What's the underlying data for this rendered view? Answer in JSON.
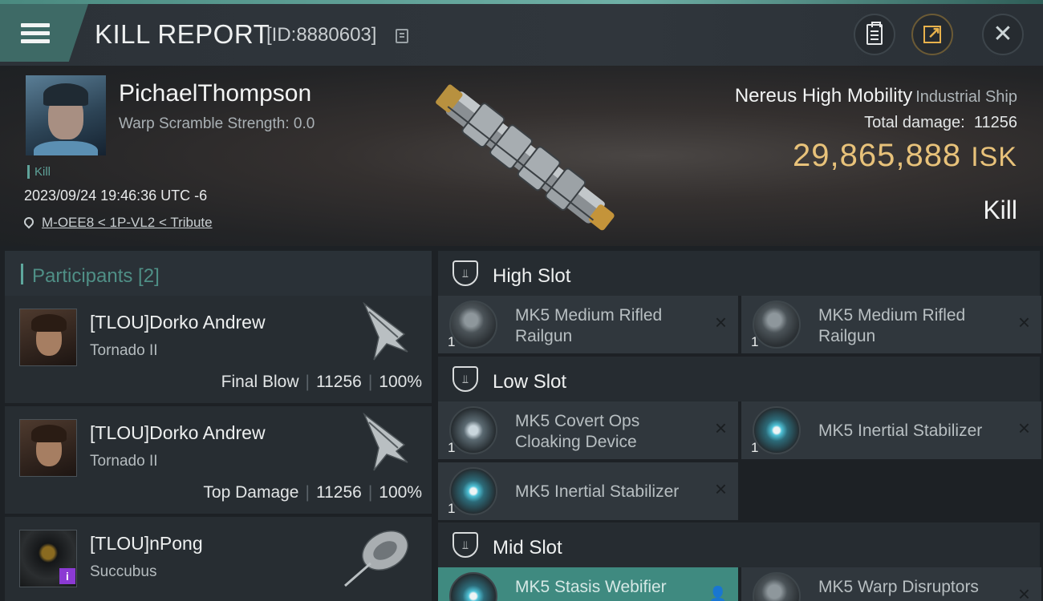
{
  "header": {
    "title": "KILL REPORT",
    "report_id": "[ID:8880603]"
  },
  "victim": {
    "name": "PichaelThompson",
    "warp_scramble": "Warp Scramble Strength: 0.0",
    "tag": "Kill",
    "timestamp": "2023/09/24 19:46:36 UTC -6",
    "location": "M-OEE8 < 1P-VL2 < Tribute",
    "ship_name": "Nereus High Mobility",
    "ship_class": "Industrial Ship",
    "total_damage_label": "Total damage:",
    "total_damage_value": "11256",
    "isk_value": "29,865,888",
    "isk_unit": "ISK",
    "result": "Kill"
  },
  "participants": {
    "header": "Participants [2]",
    "items": [
      {
        "name": "[TLOU]Dorko Andrew",
        "ship": "Tornado II",
        "role": "Final Blow",
        "damage": "11256",
        "percent": "100%"
      },
      {
        "name": "[TLOU]Dorko Andrew",
        "ship": "Tornado II",
        "role": "Top Damage",
        "damage": "11256",
        "percent": "100%"
      },
      {
        "name": "[TLOU]nPong",
        "ship": "Succubus",
        "badge": "i"
      }
    ]
  },
  "slots": {
    "high": {
      "label": "High Slot",
      "modules": [
        {
          "name": "MK5 Medium Rifled Railgun",
          "qty": "1"
        },
        {
          "name": "MK5 Medium Rifled Railgun",
          "qty": "1"
        }
      ]
    },
    "low": {
      "label": "Low Slot",
      "modules": [
        {
          "name": "MK5 Covert Ops Cloaking Device",
          "qty": "1"
        },
        {
          "name": "MK5 Inertial Stabilizer",
          "qty": "1"
        },
        {
          "name": "MK5 Inertial Stabilizer",
          "qty": "1"
        }
      ]
    },
    "mid": {
      "label": "Mid Slot",
      "modules": [
        {
          "name": "MK5 Stasis Webifier",
          "qty": "1"
        },
        {
          "name": "MK5 Warp Disruptors",
          "qty": "1"
        }
      ]
    }
  },
  "icons": {
    "remove": "×",
    "slot": "shield-icon"
  },
  "colors": {
    "accent": "#5ea79d",
    "isk": "#e8c27a",
    "active_module": "#3f8a80",
    "badge": "#8b3ad3"
  }
}
